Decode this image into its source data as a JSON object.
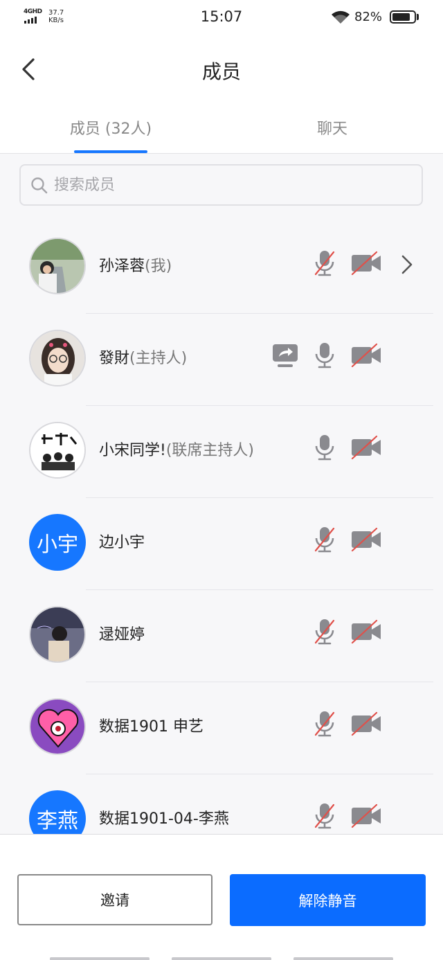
{
  "status_bar": {
    "network": "4GHD",
    "speed_value": "37.7",
    "speed_unit": "KB/s",
    "time": "15:07",
    "battery_percent": "82%",
    "battery_level": 0.82
  },
  "header": {
    "title": "成员"
  },
  "tabs": [
    {
      "label": "成员 (32人)",
      "active": true
    },
    {
      "label": "聊天",
      "active": false
    }
  ],
  "search": {
    "placeholder": "搜索成员"
  },
  "members": [
    {
      "name": "孙泽蓉",
      "role": "(我)",
      "avatar": "photo",
      "mic_muted": true,
      "camera_off": true,
      "screen_share": false,
      "chevron": true
    },
    {
      "name": "發財",
      "role": "(主持人)",
      "avatar": "photo",
      "mic_muted": false,
      "camera_off": true,
      "screen_share": true,
      "chevron": false
    },
    {
      "name": "小宋同学!",
      "role": "(联席主持人)",
      "avatar": "photo",
      "mic_muted": false,
      "camera_off": true,
      "screen_share": false,
      "chevron": false
    },
    {
      "name": "边小宇",
      "role": "",
      "avatar": "text",
      "avatar_text": "小宇",
      "mic_muted": true,
      "camera_off": true,
      "screen_share": false,
      "chevron": false
    },
    {
      "name": "逯娅婷",
      "role": "",
      "avatar": "photo",
      "mic_muted": true,
      "camera_off": true,
      "screen_share": false,
      "chevron": false
    },
    {
      "name": "数据1901 申艺",
      "role": "",
      "avatar": "photo",
      "mic_muted": true,
      "camera_off": true,
      "screen_share": false,
      "chevron": false
    },
    {
      "name": "数据1901-04-李燕",
      "role": "",
      "avatar": "text",
      "avatar_text": "李燕",
      "mic_muted": true,
      "camera_off": true,
      "screen_share": false,
      "chevron": false
    }
  ],
  "footer": {
    "invite_label": "邀请",
    "unmute_label": "解除静音"
  },
  "colors": {
    "accent": "#1677ff",
    "button_primary": "#0b6cff",
    "muted_slash": "#e0504a",
    "icon_gray": "#8a8a8f"
  }
}
